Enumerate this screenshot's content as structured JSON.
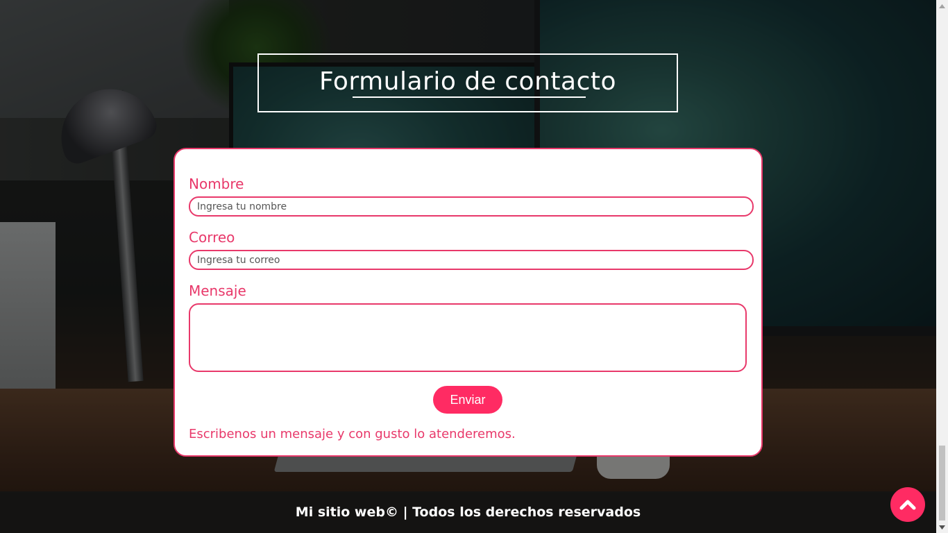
{
  "header": {
    "title": "Formulario de contacto"
  },
  "form": {
    "name_label": "Nombre",
    "name_placeholder": "Ingresa tu nombre",
    "email_label": "Correo",
    "email_placeholder": "Ingresa tu correo",
    "message_label": "Mensaje",
    "message_value": "",
    "submit_label": "Enviar",
    "footnote": "Escribenos un mensaje y con gusto lo atenderemos."
  },
  "footer": {
    "text": "Mi sitio web© | Todos los derechos reservados"
  },
  "icons": {
    "back_to_top": "chevron-up-icon"
  },
  "colors": {
    "accent": "#ff2b63",
    "border": "#e8386a",
    "footer_bg": "#141414",
    "text_light": "#ffffff"
  }
}
